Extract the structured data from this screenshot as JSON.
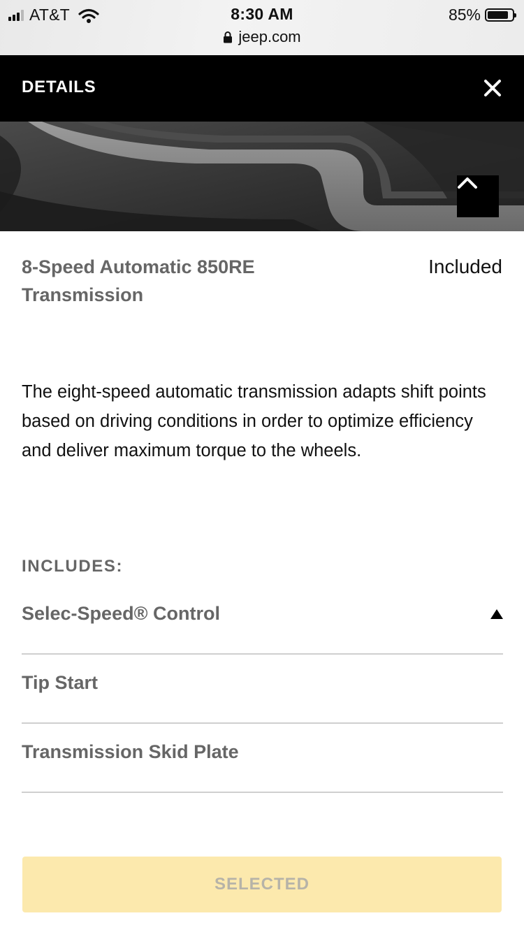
{
  "status_bar": {
    "carrier": "AT&T",
    "time": "8:30 AM",
    "url": "jeep.com",
    "battery_percent": "85%",
    "battery_level": 0.85
  },
  "header": {
    "title": "DETAILS"
  },
  "option": {
    "name": "8-Speed Automatic 850RE Transmission",
    "status": "Included",
    "description": "The eight-speed automatic transmission adapts shift points based on driving conditions in order to optimize efficiency and deliver maximum torque to the wheels."
  },
  "includes": {
    "label": "INCLUDES:",
    "items": [
      {
        "label": "Selec-Speed® Control"
      },
      {
        "label": "Tip Start"
      },
      {
        "label": "Transmission Skid Plate"
      }
    ]
  },
  "footer": {
    "selected_label": "SELECTED"
  },
  "colors": {
    "header_bg": "#000000",
    "selected_button_bg": "#fce9ad",
    "muted_text": "#666666"
  }
}
